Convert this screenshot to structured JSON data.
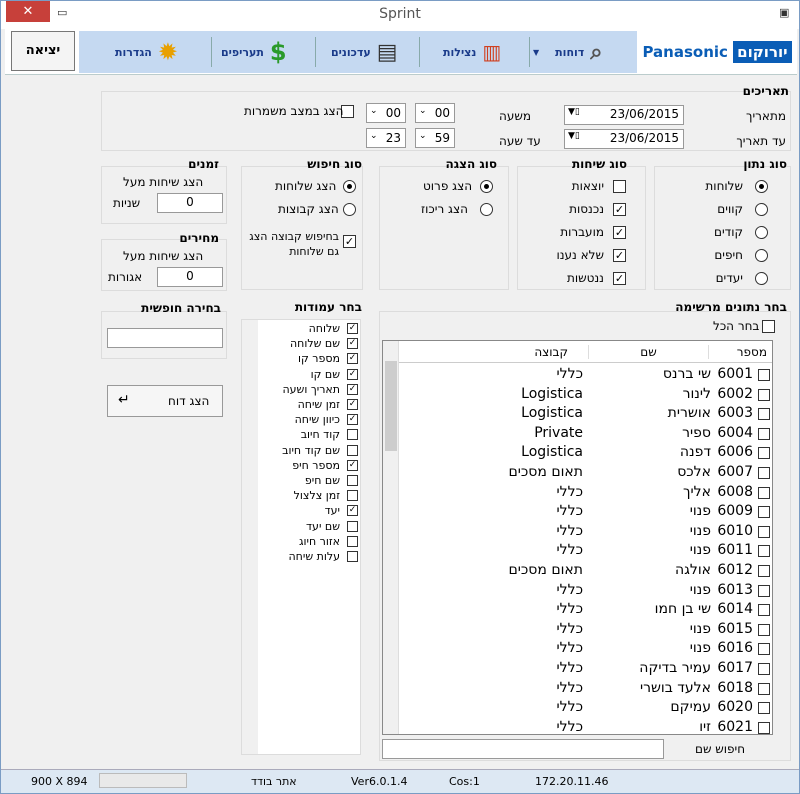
{
  "window": {
    "title": "Sprint"
  },
  "ribbon": {
    "exit": "יציאה",
    "logo_hebrew": "יורוקום",
    "logo_brand": "Panasonic",
    "items": [
      "דוחות",
      "נצילות",
      "עדכונים",
      "תעריפים",
      "הגדרות"
    ]
  },
  "dates": {
    "title": "תאריכים",
    "from_label": "מתאריך",
    "to_label": "עד תאריך",
    "from_date": "23/06/2015",
    "to_date": "23/06/2015",
    "from_hour_label": "משעה",
    "to_hour_label": "עד שעה",
    "from_h": "00",
    "from_m": "00",
    "to_h": "23",
    "to_m": "59",
    "shift_label": "הצג במצב משמרות"
  },
  "data_type": {
    "title": "סוג נתון",
    "options": [
      "שלוחות",
      "קווים",
      "קודים",
      "חיפים",
      "יעדים"
    ]
  },
  "call_type": {
    "title": "סוג שיחות",
    "options": [
      "יוצאות",
      "נכנסות",
      "מועברות",
      "שלא נענו",
      "ננטשות"
    ],
    "checked": [
      false,
      true,
      true,
      true,
      true
    ]
  },
  "display_type": {
    "title": "סוג הצגה",
    "options": [
      "הצג פרוט",
      "הצג ריכוז"
    ]
  },
  "search_type": {
    "title": "סוג חיפוש",
    "options": [
      "הצג שלוחות",
      "הצג קבוצות"
    ],
    "group_check": "בחיפוש קבוצה הצג גם שלוחות"
  },
  "times": {
    "title": "זמנים",
    "show_label": "הצג שיחות מעל",
    "value": "0",
    "unit": "שניות"
  },
  "prices": {
    "title": "מחירים",
    "show_label": "הצג שיחות מעל",
    "value": "0",
    "unit": "אגורות"
  },
  "free_choice": {
    "title": "בחירה חופשית",
    "value": ""
  },
  "show_report": "הצג דוח",
  "columns": {
    "title": "בחר עמודות",
    "items": [
      "שלוחה",
      "שם שלוחה",
      "מספר קו",
      "שם קו",
      "תאריך ושעה",
      "זמן שיחה",
      "כיוון שיחה",
      "קוד חיוב",
      "שם קוד חיוב",
      "מספר חיפ",
      "שם חיפ",
      "זמן צלצול",
      "יעד",
      "שם יעד",
      "אזור חיוג",
      "עלות שיחה"
    ],
    "checked": [
      true,
      true,
      true,
      true,
      true,
      true,
      true,
      false,
      false,
      true,
      false,
      false,
      true,
      false,
      false,
      false
    ]
  },
  "list": {
    "title": "בחר נתונים מרשימה",
    "select_all": "בחר הכל",
    "headers": [
      "מספר",
      "שם",
      "קבוצה"
    ],
    "rows": [
      [
        "6001",
        "שי ברנס",
        "כללי"
      ],
      [
        "6002",
        "לינור",
        "Logistica"
      ],
      [
        "6003",
        "אושרית",
        "Logistica"
      ],
      [
        "6004",
        "ספיר",
        "Private"
      ],
      [
        "6006",
        "דפנה",
        "Logistica"
      ],
      [
        "6007",
        "אלכס",
        "תאום מסכים"
      ],
      [
        "6008",
        "אליך",
        "כללי"
      ],
      [
        "6009",
        "פנוי",
        "כללי"
      ],
      [
        "6010",
        "פנוי",
        "כללי"
      ],
      [
        "6011",
        "פנוי",
        "כללי"
      ],
      [
        "6012",
        "אולגה",
        "תאום מסכים"
      ],
      [
        "6013",
        "פנוי",
        "כללי"
      ],
      [
        "6014",
        "שי בן חמו",
        "כללי"
      ],
      [
        "6015",
        "פנוי",
        "כללי"
      ],
      [
        "6016",
        "פנוי",
        "כללי"
      ],
      [
        "6017",
        "עמיר בדיקה",
        "כללי"
      ],
      [
        "6018",
        "אלעד בושרי",
        "כללי"
      ],
      [
        "6020",
        "עמיקם",
        "כללי"
      ],
      [
        "6021",
        "זיו",
        "כללי"
      ]
    ],
    "search_label": "חיפוש שם",
    "search_value": ""
  },
  "status": {
    "resolution": "900 X 894",
    "user": "אתר בודד",
    "version": "Ver6.0.1.4",
    "cos": "Cos:1",
    "ip": "172.20.11.46"
  }
}
